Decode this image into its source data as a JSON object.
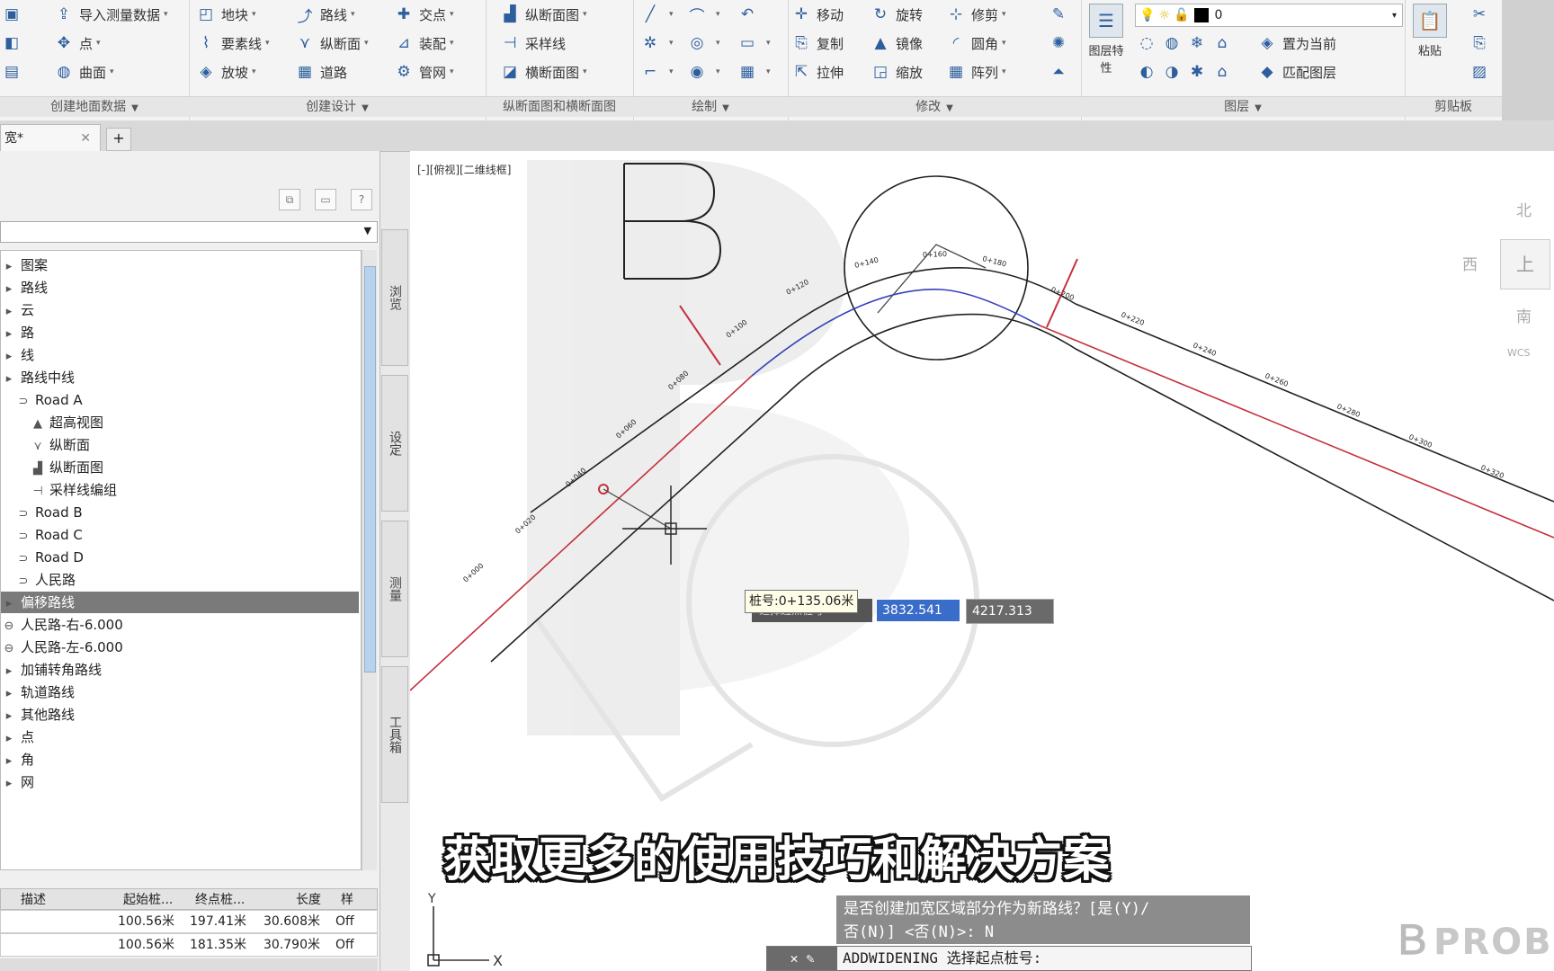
{
  "ribbon": {
    "panels": [
      {
        "title": "创建地面数据",
        "items": [
          "导入测量数据",
          "点",
          "曲面"
        ]
      },
      {
        "title": "创建设计",
        "items": [
          "地块",
          "路线",
          "交点",
          "要素线",
          "纵断面",
          "装配",
          "放坡",
          "道路",
          "管网"
        ]
      },
      {
        "title": "纵断面图和横断面图",
        "items": [
          "纵断面图",
          "采样线",
          "横断面图"
        ]
      },
      {
        "title": "绘制",
        "items": []
      },
      {
        "title": "修改",
        "items": [
          "移动",
          "旋转",
          "修剪",
          "复制",
          "镜像",
          "圆角",
          "拉伸",
          "缩放",
          "阵列"
        ]
      },
      {
        "title": "图层",
        "items": [
          "图层特性",
          "置为当前",
          "匹配图层"
        ]
      },
      {
        "title": "剪贴板",
        "items": [
          "粘贴"
        ]
      }
    ],
    "layer_value": "0"
  },
  "tabs": {
    "doc_label": "宽*"
  },
  "toolspace": {
    "tree": [
      {
        "label": "图案",
        "icon": "folder-icon"
      },
      {
        "label": "路线",
        "icon": "folder-icon"
      },
      {
        "label": "云",
        "icon": "folder-icon"
      },
      {
        "label": "路",
        "icon": "folder-icon"
      },
      {
        "label": "线",
        "icon": "folder-icon"
      },
      {
        "label": "路线中线",
        "icon": "folder-icon"
      },
      {
        "label": "Road A",
        "icon": "alignment-icon"
      },
      {
        "label": "超高视图",
        "icon": "superelevation-icon"
      },
      {
        "label": "纵断面",
        "icon": "profile-icon"
      },
      {
        "label": "纵断面图",
        "icon": "profile-view-icon"
      },
      {
        "label": "采样线编组",
        "icon": "sample-line-icon"
      },
      {
        "label": "Road B",
        "icon": "alignment-icon"
      },
      {
        "label": "Road C",
        "icon": "alignment-icon"
      },
      {
        "label": "Road D",
        "icon": "alignment-icon"
      },
      {
        "label": "人民路",
        "icon": "alignment-icon"
      },
      {
        "label": "偏移路线",
        "icon": "folder-icon",
        "selected": true
      },
      {
        "label": "人民路-右-6.000",
        "icon": "offset-alignment-icon"
      },
      {
        "label": "人民路-左-6.000",
        "icon": "offset-alignment-icon"
      },
      {
        "label": "加铺转角路线",
        "icon": "folder-icon"
      },
      {
        "label": "轨道路线",
        "icon": "folder-icon"
      },
      {
        "label": "其他路线",
        "icon": "folder-icon"
      },
      {
        "label": "点",
        "icon": "folder-icon"
      },
      {
        "label": "角",
        "icon": "folder-icon"
      },
      {
        "label": "网",
        "icon": "folder-icon"
      }
    ],
    "vertical_tabs": [
      "浏览",
      "设定",
      "测量",
      "工具箱"
    ],
    "grid": {
      "headers": [
        "描述",
        "起始桩...",
        "终点桩...",
        "长度",
        "样"
      ],
      "rows": [
        [
          "",
          "100.56米",
          "197.41米",
          "30.608米",
          "Off"
        ],
        [
          "",
          "100.56米",
          "181.35米",
          "30.790米",
          "Off"
        ]
      ]
    }
  },
  "canvas": {
    "view_label": "[-][俯视][二维线框]",
    "compass": {
      "north": "北",
      "west": "西",
      "south": "南",
      "top": "上",
      "wcs": "WCS"
    },
    "station_tooltip": "桩号:0+135.06米",
    "dyn_prompt": "选择起点桩号",
    "dyn_x": "3832.541",
    "dyn_y": "4217.313",
    "stations": [
      "0+000",
      "0+020",
      "0+040",
      "0+060",
      "0+080",
      "0+100",
      "0+120",
      "0+140",
      "0+160",
      "0+180",
      "0+200",
      "0+220",
      "0+240",
      "0+260",
      "0+280",
      "0+300",
      "0+320",
      "0+340",
      "0+360"
    ]
  },
  "command": {
    "history1": "是否创建加宽区域部分作为新路线？[是(Y)/",
    "history2": "否(N)] <否(N)>: N",
    "btn": "✕ ✎",
    "current": "ADDWIDENING 选择起点桩号:"
  },
  "subtitle": "获取更多的使用技巧和解决方案",
  "brand": "PROB"
}
